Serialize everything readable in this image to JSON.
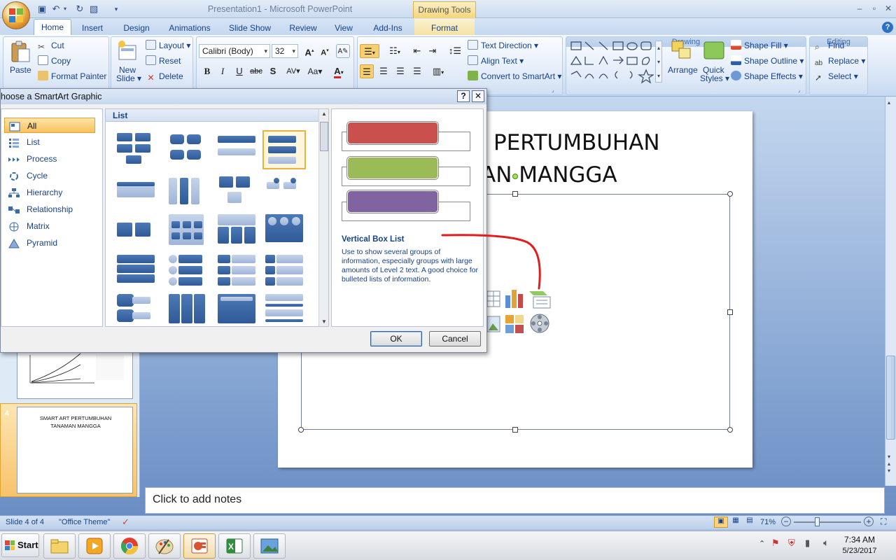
{
  "window": {
    "title": "Presentation1 - Microsoft PowerPoint",
    "context_tool": "Drawing Tools"
  },
  "tabs": [
    "Home",
    "Insert",
    "Design",
    "Animations",
    "Slide Show",
    "Review",
    "View",
    "Add-Ins",
    "Format"
  ],
  "ribbon": {
    "clipboard": {
      "paste": "Paste",
      "cut": "Cut",
      "copy": "Copy",
      "format_painter": "Format Painter"
    },
    "slides": {
      "new_slide_line1": "New",
      "new_slide_line2": "Slide",
      "layout": "Layout",
      "reset": "Reset",
      "delete": "Delete"
    },
    "font": {
      "family": "Calibri (Body)",
      "size": "32"
    },
    "paragraph": {
      "text_direction": "Text Direction",
      "align_text": "Align Text",
      "convert_smartart": "Convert to SmartArt"
    },
    "drawing": {
      "label": "Drawing",
      "arrange": "Arrange",
      "quick_styles_1": "Quick",
      "quick_styles_2": "Styles",
      "shape_fill": "Shape Fill",
      "shape_outline": "Shape Outline",
      "shape_effects": "Shape Effects"
    },
    "editing": {
      "label": "Editing",
      "find": "Find",
      "replace": "Replace",
      "select": "Select"
    }
  },
  "dialog": {
    "title": "hoose a SmartArt Graphic",
    "help": "?",
    "close": "✕",
    "categories": [
      "All",
      "List",
      "Process",
      "Cycle",
      "Hierarchy",
      "Relationship",
      "Matrix",
      "Pyramid"
    ],
    "gallery_header": "List",
    "preview_name": "Vertical Box List",
    "preview_desc": "Use to show several groups of information, especially groups with large amounts of Level 2 text. A good choice for bulleted lists of information.",
    "ok": "OK",
    "cancel": "Cancel",
    "preview_colors": [
      "#c9504d",
      "#9bbb59",
      "#8064a2"
    ]
  },
  "slide": {
    "title_line1": "PERTUMBUHAN",
    "title_line2": "AN MANGGA"
  },
  "thumbnail": {
    "number": "4",
    "title": "SMART ART PERTUMBUHAN TANAMAN MANGGA"
  },
  "notes_placeholder": "Click to add notes",
  "status": {
    "slide_info": "Slide 4 of 4",
    "theme": "\"Office Theme\"",
    "zoom": "71%"
  },
  "taskbar": {
    "start": "Start",
    "time": "7:34 AM",
    "date": "5/23/2017"
  }
}
